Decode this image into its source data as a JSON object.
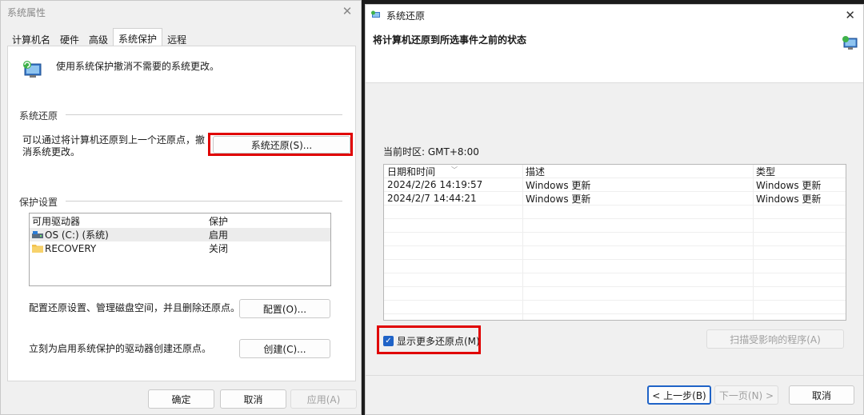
{
  "left_window": {
    "title": "系统属性",
    "tabs": [
      "计算机名",
      "硬件",
      "高级",
      "系统保护",
      "远程"
    ],
    "active_tab": 3,
    "intro_text": "使用系统保护撤消不需要的系统更改。",
    "restore_group_title": "系统还原",
    "restore_desc": "可以通过将计算机还原到上一个还原点，撤消系统更改。",
    "restore_button": "系统还原(S)...",
    "protection_group_title": "保护设置",
    "drive_table": {
      "headers": [
        "可用驱动器",
        "保护"
      ],
      "rows": [
        {
          "name": "OS (C:) (系统)",
          "protection": "启用",
          "icon": "system-drive-icon"
        },
        {
          "name": "RECOVERY",
          "protection": "关闭",
          "icon": "folder-icon"
        }
      ]
    },
    "configure_text": "配置还原设置、管理磁盘空间，并且删除还原点。",
    "configure_button": "配置(O)...",
    "create_text": "立刻为启用系统保护的驱动器创建还原点。",
    "create_button": "创建(C)...",
    "ok_button": "确定",
    "cancel_button": "取消",
    "apply_button": "应用(A)"
  },
  "right_window": {
    "title": "系统还原",
    "header_title": "将计算机还原到所选事件之前的状态",
    "timezone": "当前时区: GMT+8:00",
    "table": {
      "headers": [
        "日期和时间",
        "描述",
        "类型"
      ],
      "rows": [
        {
          "date": "2024/2/26 14:19:57",
          "desc": "Windows 更新",
          "type": "Windows 更新"
        },
        {
          "date": "2024/2/7 14:44:21",
          "desc": "Windows 更新",
          "type": "Windows 更新"
        }
      ]
    },
    "show_more_label": "显示更多还原点(M)",
    "show_more_checked": true,
    "scan_button": "扫描受影响的程序(A)",
    "back_button": "< 上一步(B)",
    "next_button": "下一页(N) >",
    "cancel_button": "取消"
  },
  "colors": {
    "highlight_red": "#e00000",
    "accent_blue": "#1f63c7"
  }
}
